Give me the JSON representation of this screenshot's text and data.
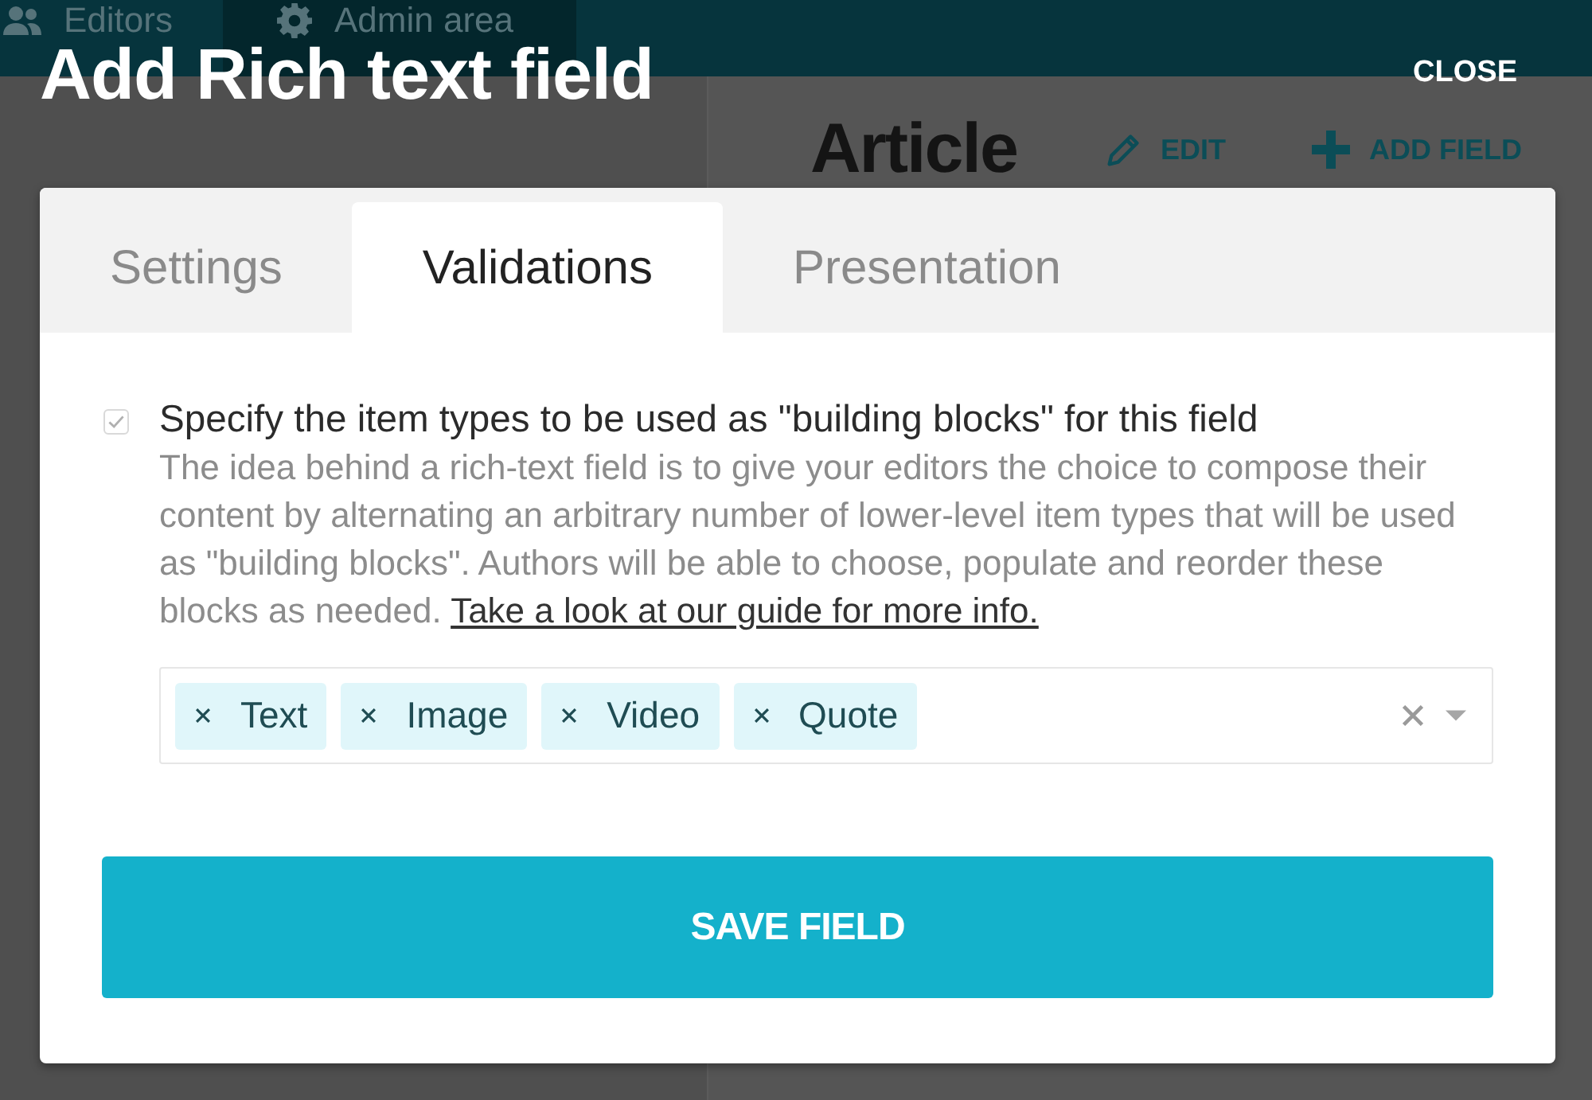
{
  "background_app": {
    "nav": [
      {
        "label": "Editors"
      },
      {
        "label": "Admin area"
      }
    ],
    "page_title": "Article",
    "actions": [
      {
        "kind": "edit",
        "label": "EDIT"
      },
      {
        "kind": "add",
        "label": "ADD FIELD"
      }
    ]
  },
  "dialog": {
    "title": "Add Rich text field",
    "close_label": "CLOSE",
    "tabs": [
      {
        "label": "Settings",
        "selected": false
      },
      {
        "label": "Validations",
        "selected": true
      },
      {
        "label": "Presentation",
        "selected": false
      }
    ],
    "building_blocks": {
      "checked": true,
      "disabled": true,
      "label": "Specify the item types to be used as \"building blocks\" for this field",
      "description": "The idea behind a rich-text field is to give your editors the choice to compose their content by alternating an arbitrary number of lower-level item types that will be used as \"building blocks\". Authors will be able to choose, populate and reorder these blocks as needed.",
      "link": "Take a look at our guide for more info."
    },
    "item_types": [
      {
        "label": "Text"
      },
      {
        "label": "Image"
      },
      {
        "label": "Video"
      },
      {
        "label": "Quote"
      }
    ],
    "save_button": "SAVE FIELD"
  }
}
